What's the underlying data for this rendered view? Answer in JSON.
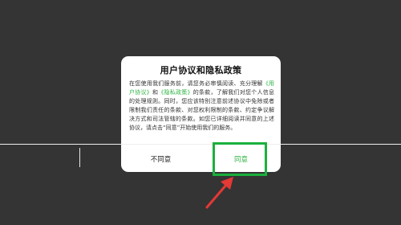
{
  "dialog": {
    "title": "用户协议和隐私政策",
    "text_before_link1": "在您使用我们服务前，请您务必审慎阅读、充分理解",
    "link1": "《用户协议》",
    "text_between": "和",
    "link2": "《隐私政策》",
    "text_after": "的条款，了解我们对您个人信息的处理规则。同时，您应该特别注意前述协议中免除或者限制我们责任的条款、对您权利限制的条款、约定争议解决方式和司法管辖的条款。如您已详细阅读并同意的上述协议，请点击“同意”开始使用我们的服务。",
    "decline_label": "不同意",
    "agree_label": "同意"
  },
  "colors": {
    "accent_green": "#2fb344",
    "highlight_green": "#1ab03d",
    "annotation_red": "#e53935",
    "backdrop": "#343434"
  }
}
